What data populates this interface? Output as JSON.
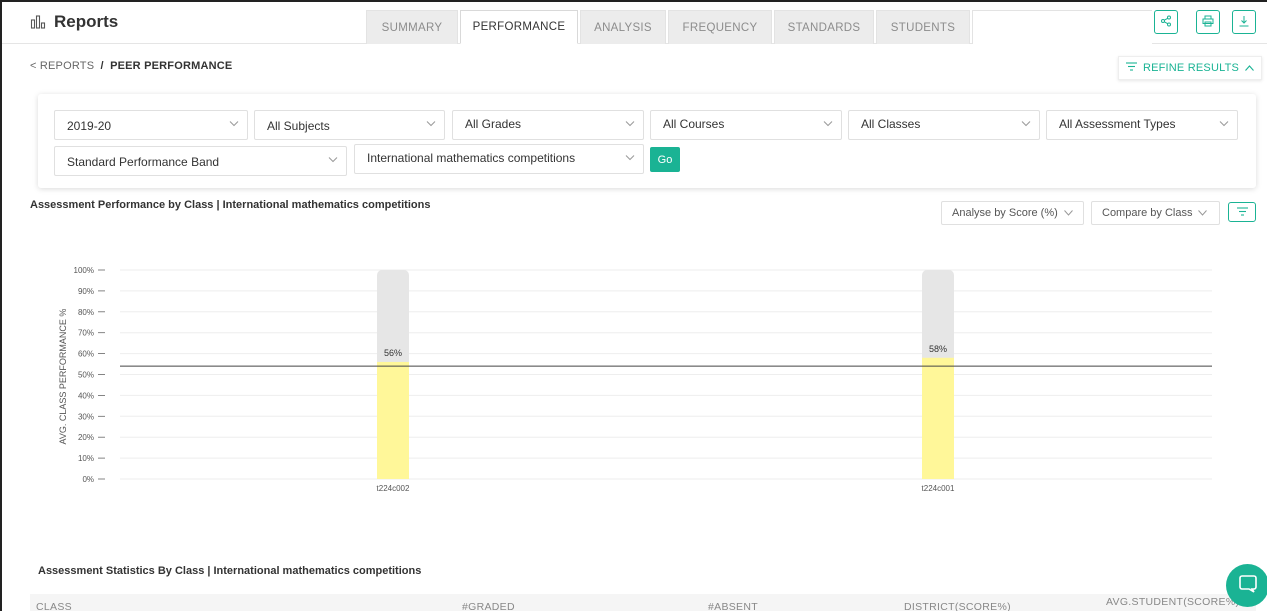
{
  "header": {
    "title": "Reports",
    "tabs": [
      {
        "label": "SUMMARY"
      },
      {
        "label": "PERFORMANCE"
      },
      {
        "label": "ANALYSIS"
      },
      {
        "label": "FREQUENCY"
      },
      {
        "label": "STANDARDS"
      },
      {
        "label": "STUDENTS"
      }
    ],
    "icons": [
      "share-icon",
      "print-icon",
      "download-icon"
    ]
  },
  "breadcrumb": {
    "back": "< REPORTS",
    "separator": "/",
    "current": "PEER PERFORMANCE"
  },
  "refine": {
    "label": "REFINE RESULTS"
  },
  "filters": {
    "year": "2019-20",
    "subjects": "All Subjects",
    "grades": "All Grades",
    "courses": "All Courses",
    "classes": "All Classes",
    "assessment_types": "All Assessment Types",
    "band": "Standard Performance Band",
    "assessment": "International mathematics competitions",
    "go_label": "Go"
  },
  "chart_section": {
    "title": "Assessment Performance by Class | International mathematics competitions",
    "analyse_by": "Analyse by Score (%)",
    "compare_by": "Compare by Class"
  },
  "chart_data": {
    "type": "bar",
    "ylabel": "AVG. CLASS PERFORMANCE %",
    "ylim": [
      0,
      100
    ],
    "yticks": [
      "100%",
      "90%",
      "80%",
      "70%",
      "60%",
      "50%",
      "40%",
      "30%",
      "20%",
      "10%",
      "0%"
    ],
    "categories": [
      "t224c002",
      "t224c001"
    ],
    "values": [
      56,
      58
    ],
    "value_labels": [
      "56%",
      "58%"
    ],
    "reference_line": 54,
    "bar_color": "#fff799",
    "track_color": "#e6e6e6"
  },
  "table_section": {
    "title": "Assessment Statistics By Class | International mathematics competitions",
    "columns": [
      "CLASS",
      "#GRADED",
      "#ABSENT",
      "DISTRICT(SCORE%)",
      "AVG.STUDENT(SCORE%)"
    ]
  },
  "colors": {
    "accent": "#1ab394"
  }
}
